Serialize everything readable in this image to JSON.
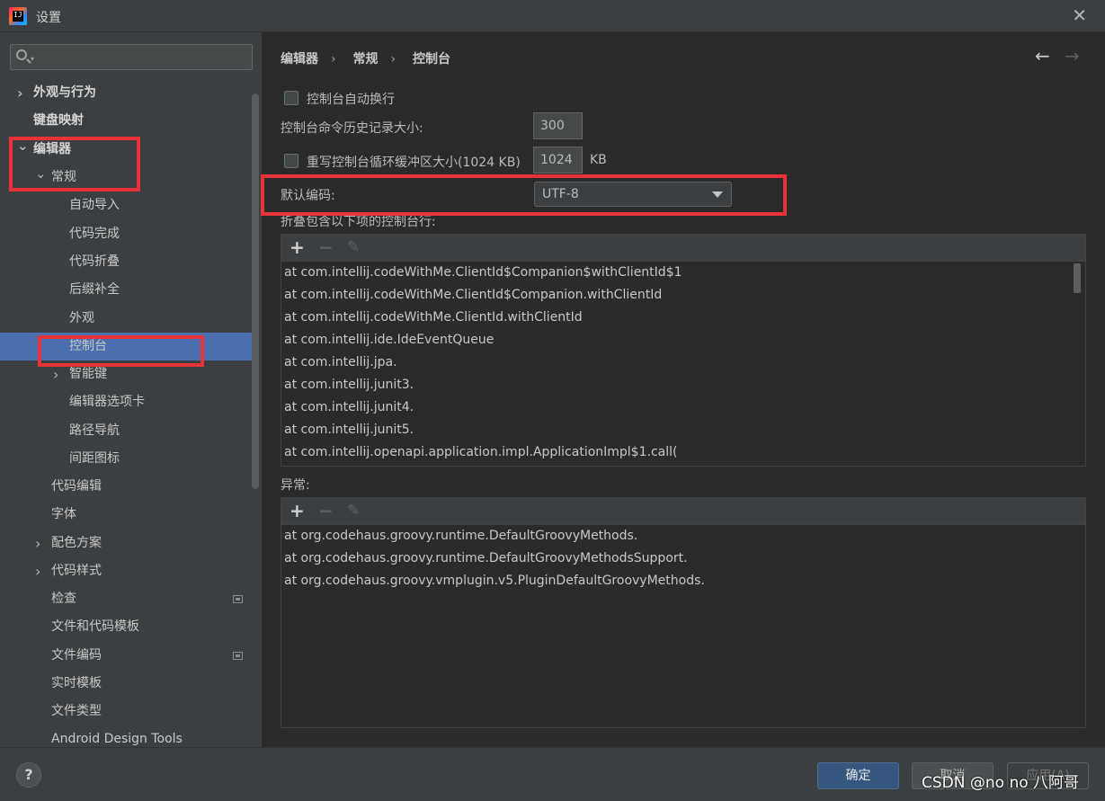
{
  "window": {
    "title": "设置",
    "app_icon_text": "IJ"
  },
  "sidebar": {
    "search_placeholder": "",
    "items": [
      {
        "label": "外观与行为",
        "bold": true,
        "chevron": "right"
      },
      {
        "label": "键盘映射",
        "bold": true
      },
      {
        "label": "编辑器",
        "bold": true,
        "chevron": "down"
      },
      {
        "label": "常规",
        "chevron": "down"
      },
      {
        "label": "自动导入"
      },
      {
        "label": "代码完成"
      },
      {
        "label": "代码折叠"
      },
      {
        "label": "后缀补全"
      },
      {
        "label": "外观"
      },
      {
        "label": "控制台",
        "selected": true
      },
      {
        "label": "智能键",
        "chevron": "right"
      },
      {
        "label": "编辑器选项卡"
      },
      {
        "label": "路径导航"
      },
      {
        "label": "间距图标"
      },
      {
        "label": "代码编辑"
      },
      {
        "label": "字体"
      },
      {
        "label": "配色方案",
        "chevron": "right"
      },
      {
        "label": "代码样式",
        "chevron": "right"
      },
      {
        "label": "检查",
        "badge": true
      },
      {
        "label": "文件和代码模板"
      },
      {
        "label": "文件编码",
        "badge": true
      },
      {
        "label": "实时模板"
      },
      {
        "label": "文件类型"
      },
      {
        "label": "Android Design Tools"
      }
    ]
  },
  "breadcrumb": [
    "编辑器",
    "常规",
    "控制台"
  ],
  "nav": {
    "back_icon": "arrow-left-icon",
    "forward_icon": "arrow-right-icon"
  },
  "settings": {
    "soft_wrap_label": "控制台自动换行",
    "soft_wrap_checked": false,
    "history_label": "控制台命令历史记录大小:",
    "history_value": "300",
    "override_buffer_label": "重写控制台循环缓冲区大小(1024 KB)",
    "override_buffer_checked": false,
    "buffer_value": "1024",
    "buffer_unit": "KB",
    "encoding_label": "默认编码:",
    "encoding_value": "UTF-8",
    "fold_label": "折叠包含以下项的控制台行:",
    "fold_lines": [
      "at com.intellij.codeWithMe.ClientId$Companion$withClientId$1",
      "at com.intellij.codeWithMe.ClientId$Companion.withClientId",
      "at com.intellij.codeWithMe.ClientId.withClientId",
      "at com.intellij.ide.IdeEventQueue",
      "at com.intellij.jpa.",
      "at com.intellij.junit3.",
      "at com.intellij.junit4.",
      "at com.intellij.junit5.",
      "at com.intellij.openapi.application.impl.ApplicationImpl$1.call("
    ],
    "exceptions_label": "异常:",
    "exception_lines": [
      "at org.codehaus.groovy.runtime.DefaultGroovyMethods.",
      "at org.codehaus.groovy.runtime.DefaultGroovyMethodsSupport.",
      "at org.codehaus.groovy.vmplugin.v5.PluginDefaultGroovyMethods."
    ],
    "toolbar": {
      "add": "+",
      "remove": "−",
      "edit": "✎"
    }
  },
  "footer": {
    "help": "?",
    "ok": "确定",
    "cancel": "取消",
    "apply": "应用(A)",
    "watermark": "CSDN @no no 八阿哥"
  },
  "colors": {
    "accent": "#4b6eaf",
    "highlight": "#e8333a",
    "ok_button": "#365880"
  }
}
